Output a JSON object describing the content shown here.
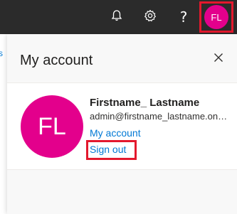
{
  "topbar": {
    "notifications_icon": "bell-icon",
    "settings_icon": "gear-icon",
    "help_glyph": "?",
    "avatar_initials": "FL"
  },
  "background_page": {
    "sliver_text": "s"
  },
  "account_panel": {
    "title": "My account",
    "close_icon": "close-icon",
    "user": {
      "initials": "FL",
      "name": "Firstname_ Lastname",
      "email": "admin@firstname_lastname.onmicrosoft.com"
    },
    "links": {
      "my_account": "My account",
      "sign_out": "Sign out"
    }
  },
  "colors": {
    "topbar": "#2b2b2b",
    "avatar": "#e3008c",
    "link": "#0078d4",
    "highlight": "#e3182d"
  }
}
